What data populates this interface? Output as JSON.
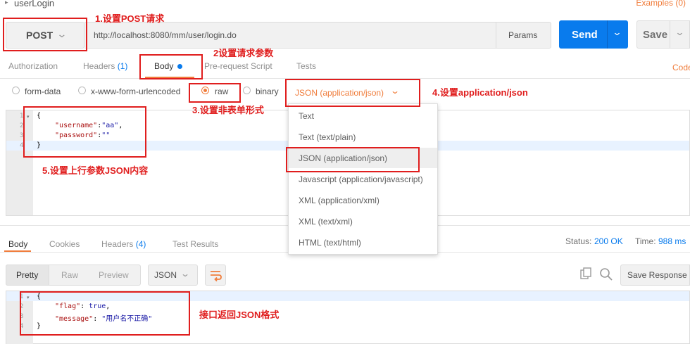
{
  "request": {
    "title": "userLogin",
    "examples_label": "Examples (0)",
    "method": "POST",
    "url": "http://localhost:8080/mm/user/login.do",
    "params_label": "Params",
    "send_label": "Send",
    "save_label": "Save"
  },
  "request_tabs": [
    {
      "label": "Authorization",
      "count": ""
    },
    {
      "label": "Headers",
      "count": "(1)"
    },
    {
      "label": "Body",
      "count": ""
    },
    {
      "label": "Pre-request Script",
      "count": ""
    },
    {
      "label": "Tests",
      "count": ""
    }
  ],
  "code_link": "Code",
  "body_types": [
    {
      "label": "form-data",
      "selected": false
    },
    {
      "label": "x-www-form-urlencoded",
      "selected": false
    },
    {
      "label": "raw",
      "selected": true
    },
    {
      "label": "binary",
      "selected": false
    }
  ],
  "content_type": "JSON (application/json)",
  "content_type_options": [
    "Text",
    "Text (text/plain)",
    "JSON (application/json)",
    "Javascript (application/javascript)",
    "XML (application/xml)",
    "XML (text/xml)",
    "HTML (text/html)"
  ],
  "request_body": {
    "line_numbers": [
      "1",
      "2",
      "3",
      "4"
    ],
    "l1": "{",
    "k_username": "\"username\"",
    "v_username": "\"aa\"",
    "k_password": "\"password\"",
    "v_password": "\"\"",
    "l4": "}"
  },
  "response": {
    "tabs": [
      {
        "label": "Body",
        "count": ""
      },
      {
        "label": "Cookies",
        "count": ""
      },
      {
        "label": "Headers",
        "count": "(4)"
      },
      {
        "label": "Test Results",
        "count": ""
      }
    ],
    "status_label": "Status:",
    "status_value": "200 OK",
    "time_label": "Time:",
    "time_value": "988 ms",
    "view_modes": [
      "Pretty",
      "Raw",
      "Preview"
    ],
    "format": "JSON",
    "save_response_label": "Save Response",
    "line_numbers": [
      "1",
      "2",
      "3",
      "4"
    ],
    "l1": "{",
    "k_flag": "\"flag\"",
    "v_flag": "true",
    "k_message": "\"message\"",
    "v_message": "\"用户名不正确\"",
    "l4": "}"
  },
  "annotations": {
    "a1": "1.设置POST请求",
    "a2": "2设置请求参数",
    "a3": "3.设置非表单形式",
    "a4": "4.设置application/json",
    "a5": "5.设置上行参数JSON内容",
    "a6": "接口返回JSON格式"
  },
  "colors": {
    "accent_orange": "#f07d3c",
    "send_blue": "#097bed",
    "annotation_red": "#e01e1e"
  }
}
